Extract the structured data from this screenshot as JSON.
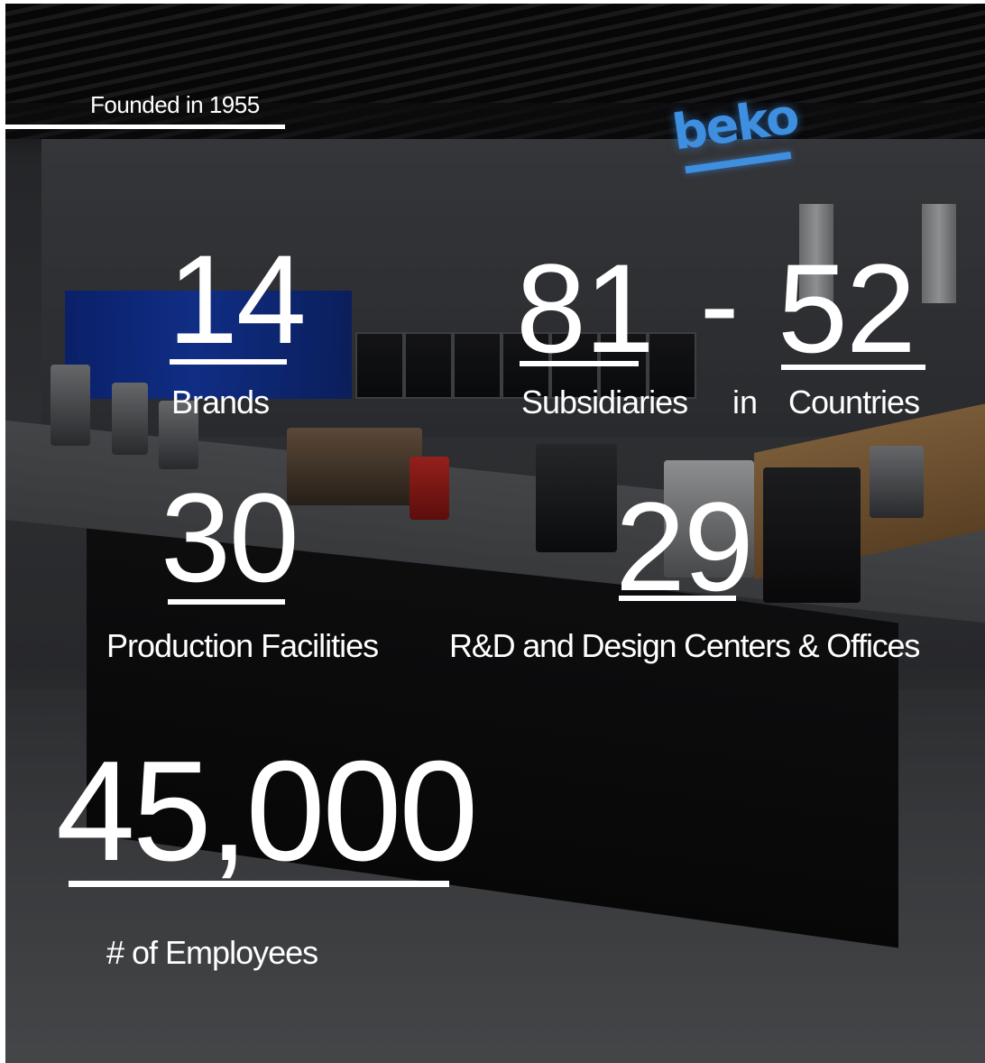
{
  "founded": "Founded in 1955",
  "brand_logo": "beko",
  "stats": {
    "brands": {
      "value": "14",
      "label": "Brands"
    },
    "subsidiaries": {
      "value": "81",
      "label": "Subsidiaries"
    },
    "dash": "-",
    "in_word": "in",
    "countries": {
      "value": "52",
      "label": "Countries"
    },
    "production": {
      "value": "30",
      "label": "Production Facilities"
    },
    "rnd": {
      "value": "29",
      "label": "R&D and Design Centers & Offices"
    },
    "employees": {
      "value": "45,000",
      "label": "# of Employees"
    }
  },
  "colors": {
    "text": "#ffffff",
    "logo_blue": "#3f8fe0",
    "accent_blue_panel": "#1446d8"
  }
}
